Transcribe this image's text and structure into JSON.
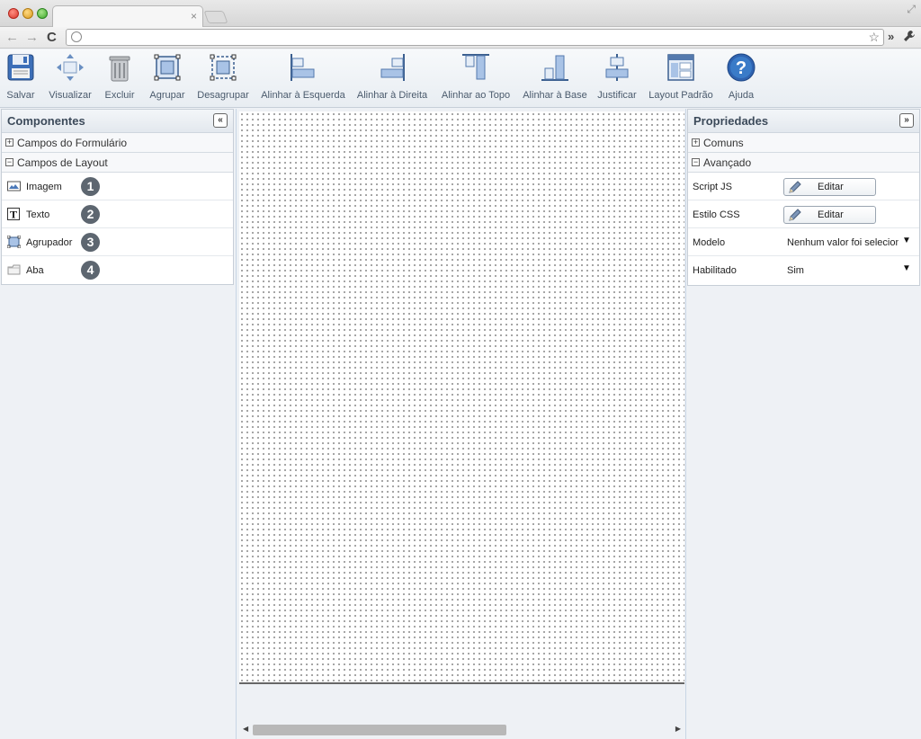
{
  "browser": {
    "tab_close": "×",
    "nav_back": "←",
    "nav_forward": "→",
    "reload": "C",
    "url": "",
    "star": "☆",
    "extensions": "»",
    "wrench": "🔧"
  },
  "toolbar": {
    "items": [
      {
        "label": "Salvar",
        "icon": "save-icon"
      },
      {
        "label": "Visualizar",
        "icon": "preview-icon"
      },
      {
        "label": "Excluir",
        "icon": "trash-icon"
      },
      {
        "label": "Agrupar",
        "icon": "group-icon"
      },
      {
        "label": "Desagrupar",
        "icon": "ungroup-icon"
      },
      {
        "label": "Alinhar à Esquerda",
        "icon": "align-left-icon"
      },
      {
        "label": "Alinhar à Direita",
        "icon": "align-right-icon"
      },
      {
        "label": "Alinhar ao Topo",
        "icon": "align-top-icon"
      },
      {
        "label": "Alinhar à Base",
        "icon": "align-bottom-icon"
      },
      {
        "label": "Justificar",
        "icon": "justify-icon"
      },
      {
        "label": "Layout Padrão",
        "icon": "default-layout-icon"
      },
      {
        "label": "Ajuda",
        "icon": "help-icon"
      }
    ]
  },
  "components_panel": {
    "title": "Componentes",
    "collapse": "«",
    "sections": [
      {
        "label": "Campos do Formulário",
        "toggle": "+"
      },
      {
        "label": "Campos de Layout",
        "toggle": "−"
      }
    ],
    "items": [
      {
        "label": "Imagem",
        "badge": "1",
        "icon": "image-icon"
      },
      {
        "label": "Texto",
        "badge": "2",
        "icon": "text-icon"
      },
      {
        "label": "Agrupador",
        "badge": "3",
        "icon": "grouper-icon"
      },
      {
        "label": "Aba",
        "badge": "4",
        "icon": "tab-icon"
      }
    ]
  },
  "properties_panel": {
    "title": "Propriedades",
    "expand": "»",
    "sections": [
      {
        "label": "Comuns",
        "toggle": "+"
      },
      {
        "label": "Avançado",
        "toggle": "−"
      }
    ],
    "rows": [
      {
        "label": "Script JS",
        "button": "Editar"
      },
      {
        "label": "Estilo CSS",
        "button": "Editar"
      },
      {
        "label": "Modelo",
        "value": "Nenhum valor foi selecionado"
      },
      {
        "label": "Habilitado",
        "value": "Sim"
      }
    ],
    "dropdown_arrow": "▼"
  },
  "canvas": {
    "scroll_left": "◀",
    "scroll_right": "▶"
  },
  "colors": {
    "accent": "#3a7bc8",
    "badge": "#5d6670",
    "panel_border": "#c7ced7"
  }
}
